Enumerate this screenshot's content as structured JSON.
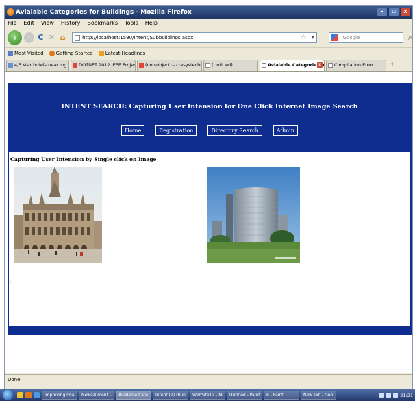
{
  "window": {
    "title": "Avialable Categories for Buildings - Mozilla Firefox",
    "minimize": "–",
    "maximize": "▫",
    "close": "x"
  },
  "menu": [
    "File",
    "Edit",
    "View",
    "History",
    "Bookmarks",
    "Tools",
    "Help"
  ],
  "nav": {
    "url": "http://localhost:1590/Intent/Subbuildings.aspx",
    "search_placeholder": "Google"
  },
  "bookmarks": [
    "Most Visited",
    "Getting Started",
    "Latest Headlines"
  ],
  "tabs": [
    {
      "label": "4/5 star hotels near mg road ban..."
    },
    {
      "label": "DOTNET 2012 IEEE Project Reso..."
    },
    {
      "label": "(no subject) - cresystechnologie..."
    },
    {
      "label": "(Untitled)"
    },
    {
      "label": "Avialable Categories for Bui...",
      "active": true
    },
    {
      "label": "Compilation Error"
    }
  ],
  "page": {
    "header_title": "INTENT SEARCH: Capturing User Intension for One Click Internet Image Search",
    "nav_buttons": [
      "Home",
      "Registration",
      "Directory Search",
      "Admin"
    ],
    "panel_title": "Capturing User Intension by Single click on Image",
    "panel_mark": ":"
  },
  "status": "Done",
  "taskbar": {
    "tasks": [
      "Improving Ima...",
      "Newsallment -...",
      "Avialable Cate...",
      "Intent (2) (Run...",
      "WebSite12 - Mi...",
      "Untitled - Paint",
      "6 - Paint",
      "New Tab - Goo..."
    ],
    "clock": "21:21"
  }
}
